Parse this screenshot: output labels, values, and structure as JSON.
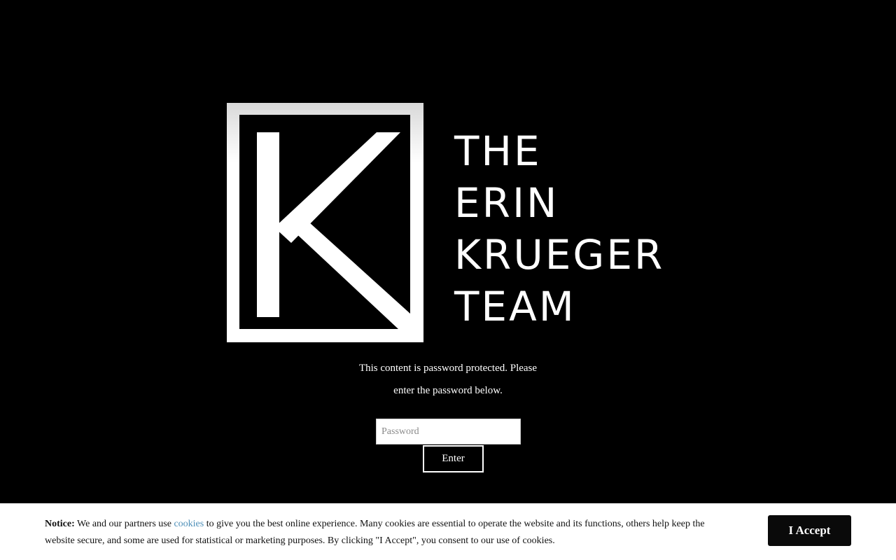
{
  "logo": {
    "text_lines": [
      "THE",
      "ERIN",
      "KRUEGER",
      "TEAM"
    ],
    "mark_icon": "letter-k-square-icon",
    "color": "#ffffff"
  },
  "protected": {
    "message_line1": "This content is password protected. Please",
    "message_line2": "enter the password below.",
    "password_placeholder": "Password",
    "password_value": "",
    "enter_label": "Enter"
  },
  "cookie_notice": {
    "notice_label": "Notice:",
    "text_before_link": " We and our partners use ",
    "link_text": "cookies",
    "text_after_link": " to give you the best online experience. Many cookies are essential to operate the website and its functions, others help keep the website secure, and some are used for statistical or marketing purposes. By clicking \"I Accept\", you consent to our use of cookies.",
    "accept_label": "I Accept",
    "link_color": "#4d8fb8"
  },
  "colors": {
    "background": "#000000",
    "foreground": "#ffffff",
    "accept_button": "#0a0a0a"
  }
}
